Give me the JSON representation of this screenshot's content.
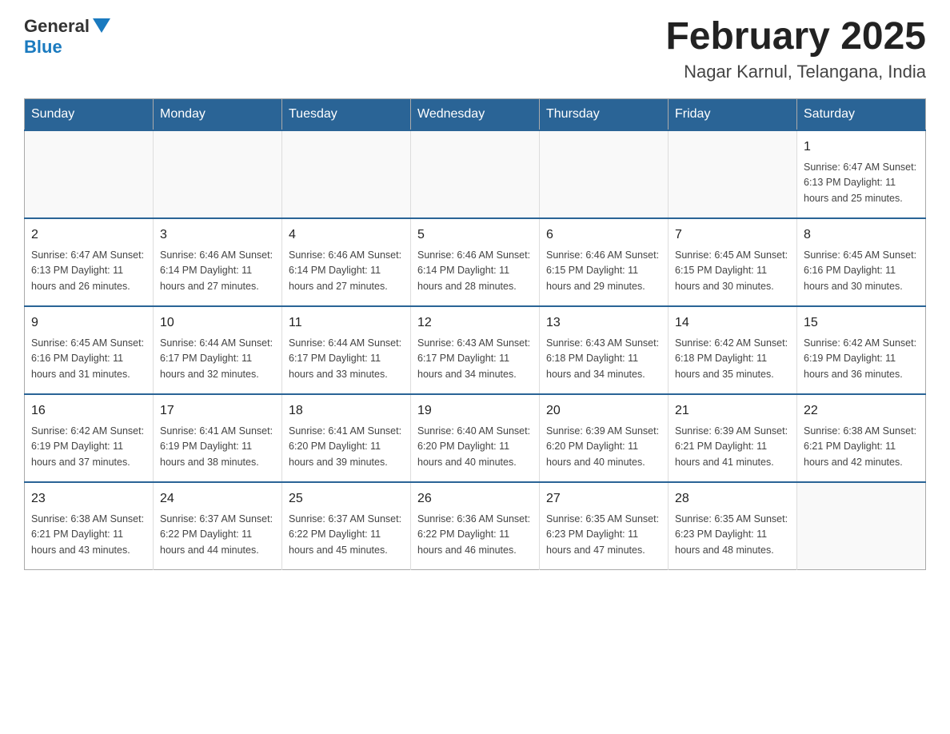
{
  "header": {
    "logo_general": "General",
    "logo_blue": "Blue",
    "title": "February 2025",
    "subtitle": "Nagar Karnul, Telangana, India"
  },
  "calendar": {
    "days_of_week": [
      "Sunday",
      "Monday",
      "Tuesday",
      "Wednesday",
      "Thursday",
      "Friday",
      "Saturday"
    ],
    "weeks": [
      [
        {
          "day": "",
          "info": ""
        },
        {
          "day": "",
          "info": ""
        },
        {
          "day": "",
          "info": ""
        },
        {
          "day": "",
          "info": ""
        },
        {
          "day": "",
          "info": ""
        },
        {
          "day": "",
          "info": ""
        },
        {
          "day": "1",
          "info": "Sunrise: 6:47 AM\nSunset: 6:13 PM\nDaylight: 11 hours\nand 25 minutes."
        }
      ],
      [
        {
          "day": "2",
          "info": "Sunrise: 6:47 AM\nSunset: 6:13 PM\nDaylight: 11 hours\nand 26 minutes."
        },
        {
          "day": "3",
          "info": "Sunrise: 6:46 AM\nSunset: 6:14 PM\nDaylight: 11 hours\nand 27 minutes."
        },
        {
          "day": "4",
          "info": "Sunrise: 6:46 AM\nSunset: 6:14 PM\nDaylight: 11 hours\nand 27 minutes."
        },
        {
          "day": "5",
          "info": "Sunrise: 6:46 AM\nSunset: 6:14 PM\nDaylight: 11 hours\nand 28 minutes."
        },
        {
          "day": "6",
          "info": "Sunrise: 6:46 AM\nSunset: 6:15 PM\nDaylight: 11 hours\nand 29 minutes."
        },
        {
          "day": "7",
          "info": "Sunrise: 6:45 AM\nSunset: 6:15 PM\nDaylight: 11 hours\nand 30 minutes."
        },
        {
          "day": "8",
          "info": "Sunrise: 6:45 AM\nSunset: 6:16 PM\nDaylight: 11 hours\nand 30 minutes."
        }
      ],
      [
        {
          "day": "9",
          "info": "Sunrise: 6:45 AM\nSunset: 6:16 PM\nDaylight: 11 hours\nand 31 minutes."
        },
        {
          "day": "10",
          "info": "Sunrise: 6:44 AM\nSunset: 6:17 PM\nDaylight: 11 hours\nand 32 minutes."
        },
        {
          "day": "11",
          "info": "Sunrise: 6:44 AM\nSunset: 6:17 PM\nDaylight: 11 hours\nand 33 minutes."
        },
        {
          "day": "12",
          "info": "Sunrise: 6:43 AM\nSunset: 6:17 PM\nDaylight: 11 hours\nand 34 minutes."
        },
        {
          "day": "13",
          "info": "Sunrise: 6:43 AM\nSunset: 6:18 PM\nDaylight: 11 hours\nand 34 minutes."
        },
        {
          "day": "14",
          "info": "Sunrise: 6:42 AM\nSunset: 6:18 PM\nDaylight: 11 hours\nand 35 minutes."
        },
        {
          "day": "15",
          "info": "Sunrise: 6:42 AM\nSunset: 6:19 PM\nDaylight: 11 hours\nand 36 minutes."
        }
      ],
      [
        {
          "day": "16",
          "info": "Sunrise: 6:42 AM\nSunset: 6:19 PM\nDaylight: 11 hours\nand 37 minutes."
        },
        {
          "day": "17",
          "info": "Sunrise: 6:41 AM\nSunset: 6:19 PM\nDaylight: 11 hours\nand 38 minutes."
        },
        {
          "day": "18",
          "info": "Sunrise: 6:41 AM\nSunset: 6:20 PM\nDaylight: 11 hours\nand 39 minutes."
        },
        {
          "day": "19",
          "info": "Sunrise: 6:40 AM\nSunset: 6:20 PM\nDaylight: 11 hours\nand 40 minutes."
        },
        {
          "day": "20",
          "info": "Sunrise: 6:39 AM\nSunset: 6:20 PM\nDaylight: 11 hours\nand 40 minutes."
        },
        {
          "day": "21",
          "info": "Sunrise: 6:39 AM\nSunset: 6:21 PM\nDaylight: 11 hours\nand 41 minutes."
        },
        {
          "day": "22",
          "info": "Sunrise: 6:38 AM\nSunset: 6:21 PM\nDaylight: 11 hours\nand 42 minutes."
        }
      ],
      [
        {
          "day": "23",
          "info": "Sunrise: 6:38 AM\nSunset: 6:21 PM\nDaylight: 11 hours\nand 43 minutes."
        },
        {
          "day": "24",
          "info": "Sunrise: 6:37 AM\nSunset: 6:22 PM\nDaylight: 11 hours\nand 44 minutes."
        },
        {
          "day": "25",
          "info": "Sunrise: 6:37 AM\nSunset: 6:22 PM\nDaylight: 11 hours\nand 45 minutes."
        },
        {
          "day": "26",
          "info": "Sunrise: 6:36 AM\nSunset: 6:22 PM\nDaylight: 11 hours\nand 46 minutes."
        },
        {
          "day": "27",
          "info": "Sunrise: 6:35 AM\nSunset: 6:23 PM\nDaylight: 11 hours\nand 47 minutes."
        },
        {
          "day": "28",
          "info": "Sunrise: 6:35 AM\nSunset: 6:23 PM\nDaylight: 11 hours\nand 48 minutes."
        },
        {
          "day": "",
          "info": ""
        }
      ]
    ]
  }
}
